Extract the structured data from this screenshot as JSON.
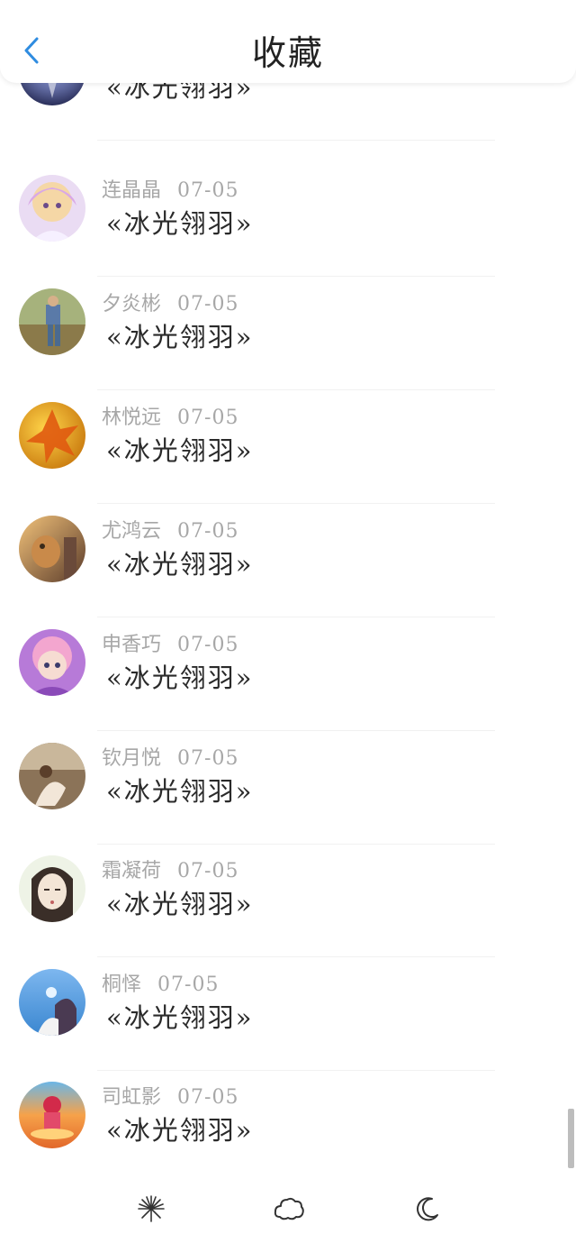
{
  "header": {
    "title": "收藏",
    "back_icon": "chevron-left-icon",
    "accent": "#2f8ce0"
  },
  "list": {
    "items": [
      {
        "name": "",
        "date": "",
        "title": "«冰光翎羽»"
      },
      {
        "name": "连晶晶",
        "date": "07-05",
        "title": "«冰光翎羽»"
      },
      {
        "name": "夕炎彬",
        "date": "07-05",
        "title": "«冰光翎羽»"
      },
      {
        "name": "林悦远",
        "date": "07-05",
        "title": "«冰光翎羽»"
      },
      {
        "name": "尤鸿云",
        "date": "07-05",
        "title": "«冰光翎羽»"
      },
      {
        "name": "申香巧",
        "date": "07-05",
        "title": "«冰光翎羽»"
      },
      {
        "name": "钦月悦",
        "date": "07-05",
        "title": "«冰光翎羽»"
      },
      {
        "name": "霜凝荷",
        "date": "07-05",
        "title": "«冰光翎羽»"
      },
      {
        "name": "桐怿",
        "date": "07-05",
        "title": "«冰光翎羽»"
      },
      {
        "name": "司虹影",
        "date": "07-05",
        "title": "«冰光翎羽»"
      }
    ]
  },
  "bottom_bar": {
    "icons": [
      "firework-icon",
      "cloud-icon",
      "moon-icon"
    ]
  }
}
